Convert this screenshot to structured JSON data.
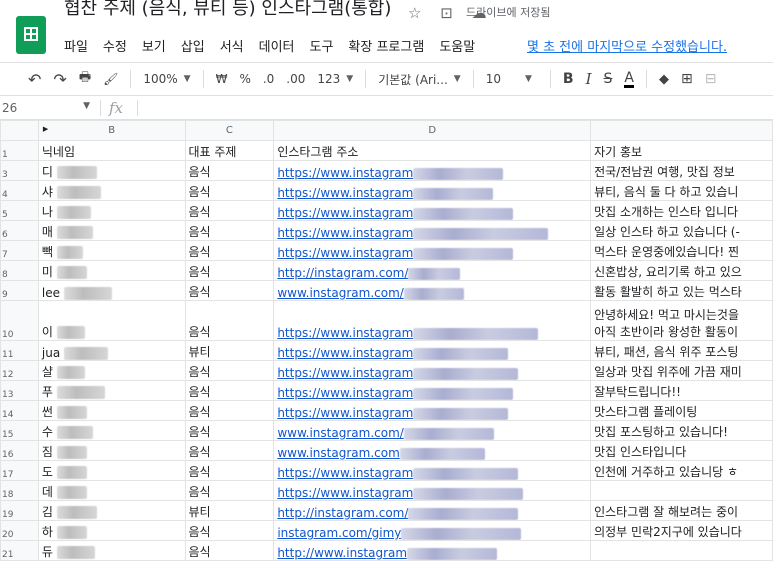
{
  "app": {
    "doc_title": "협찬 주제 (음식, 뷰티 등) 인스타그램(통합)",
    "drive_status": "드라이브에 저장됨",
    "icons": [
      "star-icon",
      "move-icon",
      "cloud-status-icon"
    ],
    "menu": [
      "파일",
      "수정",
      "보기",
      "삽입",
      "서식",
      "데이터",
      "도구",
      "확장 프로그램",
      "도움말"
    ],
    "last_edit": "몇 초 전에 마지막으로 수정했습니다."
  },
  "toolbar": {
    "undo": "↶",
    "redo": "↷",
    "print": "🖶",
    "paint_format": "🖌",
    "zoom": "100%",
    "currency": "₩",
    "percent": "%",
    "dec_decrease": ".0",
    "dec_increase": ".00",
    "more_formats": "123",
    "font": "기본값 (Ari...",
    "font_size": "10",
    "bold": "B",
    "italic": "I",
    "strike": "S",
    "text_color": "A"
  },
  "formula_bar": {
    "name_box": "26",
    "fx": "fx"
  },
  "grid": {
    "columns": [
      "B",
      "C",
      "D",
      ""
    ],
    "headers": [
      "닉네임",
      "대표 주제",
      "인스타그램 주소",
      "자기 홍보"
    ],
    "rows": [
      {
        "num": "3",
        "nick": "디",
        "topic": "음식",
        "url": "https://www.instagram",
        "promo": "전국/전남권 여행, 맛집 정보"
      },
      {
        "num": "4",
        "nick": "샤",
        "topic": "음식",
        "url": "https://www.instagram",
        "promo": "뷰티, 음식 둘 다 하고 있습니"
      },
      {
        "num": "5",
        "nick": "나",
        "topic": "음식",
        "url": "https://www.instagram",
        "promo": "맛집 소개하는 인스타 입니다"
      },
      {
        "num": "6",
        "nick": "매",
        "topic": "음식",
        "url": "https://www.instagram",
        "promo": "일상 인스타 하고 있습니다 (-"
      },
      {
        "num": "7",
        "nick": "빽",
        "topic": "음식",
        "url": "https://www.instagram",
        "promo": "먹스타 운영중에있습니다! 찐"
      },
      {
        "num": "8",
        "nick": "미",
        "topic": "음식",
        "url": "http://instagram.com/",
        "promo": "신혼밥상, 요리기록 하고 있으"
      },
      {
        "num": "9",
        "nick": "lee",
        "topic": "음식",
        "url": "www.instagram.com/",
        "promo": "활동 활발히 하고 있는 먹스타"
      },
      {
        "num": "10",
        "nick": "이",
        "topic": "음식",
        "url": "https://www.instagram",
        "promo": "안녕하세요! 먹고 마시는것을",
        "promo2": "아직 초반이라 왕성한 활동이"
      },
      {
        "num": "11",
        "nick": "jua",
        "topic": "뷰티",
        "url": "https://www.instagram",
        "promo": "뷰티, 패션, 음식 위주 포스팅"
      },
      {
        "num": "12",
        "nick": "샬",
        "topic": "음식",
        "url": "https://www.instagram",
        "promo": "일상과 맛집 위주에 가끔 재미"
      },
      {
        "num": "13",
        "nick": "푸",
        "topic": "음식",
        "url": "https://www.instagram",
        "promo": "잘부탁드립니다!!"
      },
      {
        "num": "14",
        "nick": "썬",
        "topic": "음식",
        "url": "https://www.instagram",
        "promo": "맛스타그램 플레이팅"
      },
      {
        "num": "15",
        "nick": "수",
        "topic": "음식",
        "url": "www.instagram.com/",
        "promo": "맛집 포스팅하고 있습니다!"
      },
      {
        "num": "16",
        "nick": "짐",
        "topic": "음식",
        "url": "www.instagram.com",
        "promo": "맛집 인스타입니다"
      },
      {
        "num": "17",
        "nick": "도",
        "topic": "음식",
        "url": "https://www.instagram",
        "promo": "인천에 거주하고 있습니당 ㅎ"
      },
      {
        "num": "18",
        "nick": "데",
        "topic": "음식",
        "url": "https://www.instagram",
        "promo": ""
      },
      {
        "num": "19",
        "nick": "김",
        "topic": "뷰티",
        "url": "http://instagram.com/",
        "promo": "인스타그램 잘 해보려는 중이"
      },
      {
        "num": "20",
        "nick": "하",
        "topic": "음식",
        "url": "instagram.com/gimy",
        "promo": "의정부 민락2지구에 있습니다"
      },
      {
        "num": "21",
        "nick": "듀",
        "topic": "음식",
        "url": "http://www.instagram",
        "promo": ""
      }
    ]
  }
}
